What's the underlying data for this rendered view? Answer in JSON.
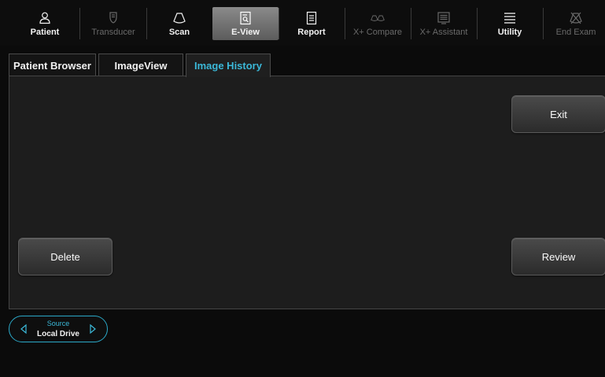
{
  "toolbar": {
    "items": [
      {
        "label": "Patient",
        "icon": "person-icon",
        "enabled": true
      },
      {
        "label": "Transducer",
        "icon": "transducer-icon",
        "enabled": false
      },
      {
        "label": "Scan",
        "icon": "scan-icon",
        "enabled": true
      },
      {
        "label": "E-View",
        "icon": "eview-icon",
        "enabled": true,
        "active": true
      },
      {
        "label": "Report",
        "icon": "report-icon",
        "enabled": true
      },
      {
        "label": "X+ Compare",
        "icon": "compare-icon",
        "enabled": false
      },
      {
        "label": "X+ Assistant",
        "icon": "assistant-icon",
        "enabled": false
      },
      {
        "label": "Utility",
        "icon": "menu-icon",
        "enabled": true
      },
      {
        "label": "End Exam",
        "icon": "end-exam-icon",
        "enabled": false
      }
    ]
  },
  "tabs": [
    {
      "label": "Patient Browser",
      "active": false
    },
    {
      "label": "ImageView",
      "active": false
    },
    {
      "label": "Image History",
      "active": true
    }
  ],
  "buttons": {
    "exit": "Exit",
    "delete": "Delete",
    "review": "Review"
  },
  "source": {
    "title": "Source",
    "value": "Local Drive"
  },
  "colors": {
    "accent": "#3bb8d8",
    "background": "#0b0b0b",
    "panel": "#1d1d1d",
    "disabled_text": "#6a6a6a"
  }
}
